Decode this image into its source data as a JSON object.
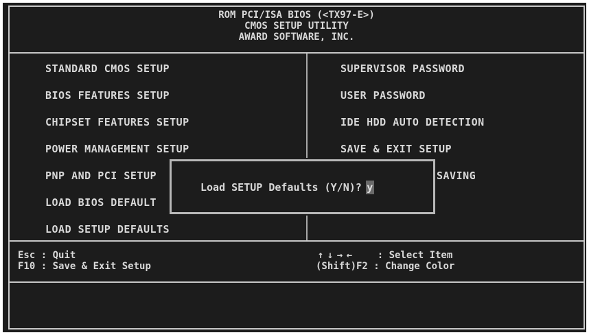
{
  "header": {
    "line1": "ROM PCI/ISA BIOS (<TX97-E>)",
    "line2": "CMOS SETUP UTILITY",
    "line3": "AWARD SOFTWARE, INC."
  },
  "menu": {
    "left": [
      "STANDARD CMOS SETUP",
      "BIOS FEATURES SETUP",
      "CHIPSET FEATURES SETUP",
      "POWER MANAGEMENT SETUP",
      "PNP AND PCI SETUP",
      "LOAD BIOS DEFAULT",
      "LOAD SETUP DEFAULTS"
    ],
    "right": [
      "SUPERVISOR PASSWORD",
      "USER PASSWORD",
      "IDE HDD AUTO DETECTION",
      "SAVE & EXIT SETUP",
      "SAVING"
    ],
    "selected": "LOAD SETUP DEFAULTS"
  },
  "footer": {
    "esc_key": "Esc",
    "esc_label": "Quit",
    "f10_key": "F10",
    "f10_label": "Save & Exit Setup",
    "arrows": [
      "↑",
      "↓",
      "→",
      "←"
    ],
    "arrows_label": "Select Item",
    "shift_key": "(Shift)F2",
    "shift_label": "Change Color"
  },
  "dialog": {
    "prompt": "Load SETUP Defaults (Y/N)?",
    "input_value": "y"
  },
  "colors": {
    "background": "#1c1c1c",
    "foreground": "#d8d8d8",
    "border": "#c8c8c8"
  }
}
